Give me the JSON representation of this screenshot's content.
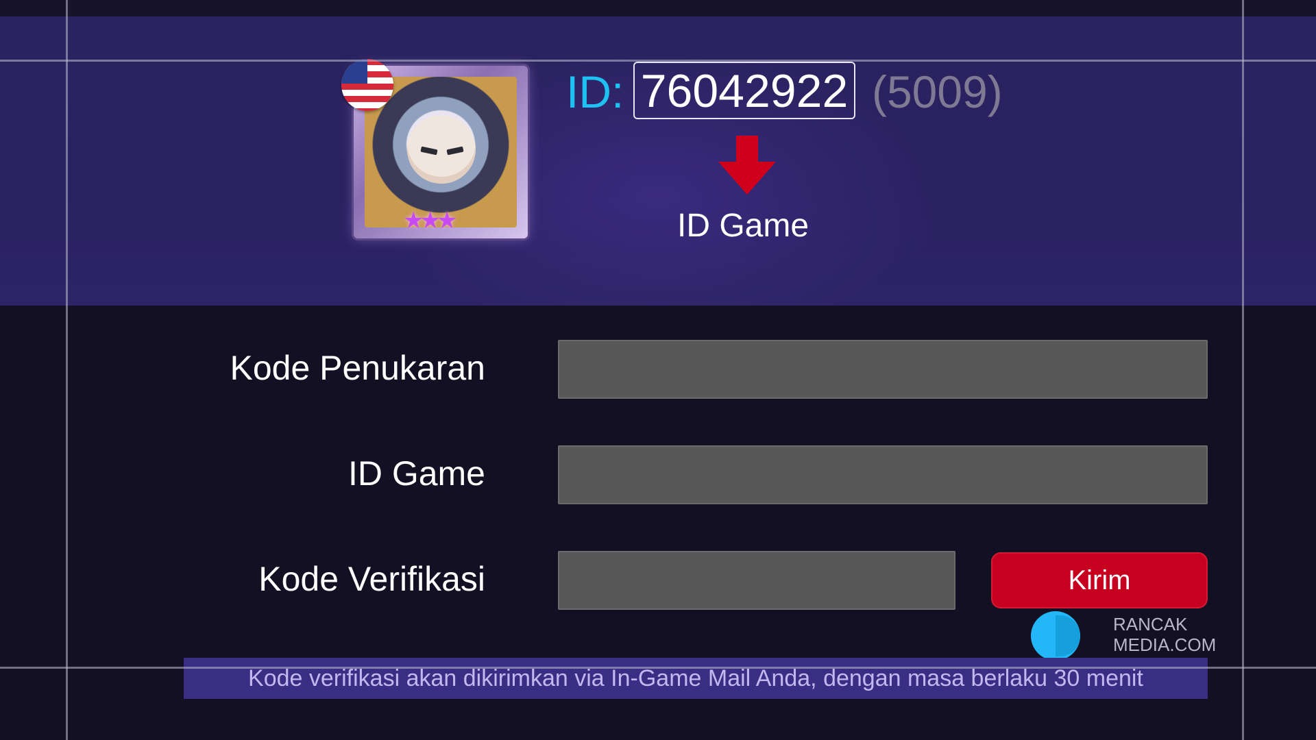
{
  "header": {
    "id_label": "ID:",
    "id_value": "76042922",
    "zone_id": "(5009)",
    "arrow_caption": "ID Game"
  },
  "form": {
    "redeem_code_label": "Kode Penukaran",
    "redeem_code_value": "",
    "game_id_label": "ID Game",
    "game_id_value": "",
    "verification_label": "Kode Verifikasi",
    "verification_value": "",
    "send_button": "Kirim"
  },
  "note": "Kode verifikasi akan dikirimkan via In-Game Mail Anda, dengan masa berlaku 30 menit",
  "watermark": {
    "line1": "RANCAK",
    "line2": "MEDIA.COM"
  },
  "colors": {
    "header_bg": "#2b2360",
    "page_bg": "#131024",
    "id_label": "#1ec1f2",
    "send_button": "#c8001f",
    "arrow": "#d0001c",
    "input_bg": "#585858",
    "note_bar": "#3a2e84"
  },
  "icons": {
    "avatar": "hero-avatar-icon",
    "flag": "us-flag-icon",
    "arrow": "arrow-down-icon",
    "watermark_logo": "rancakmedia-logo-icon"
  }
}
